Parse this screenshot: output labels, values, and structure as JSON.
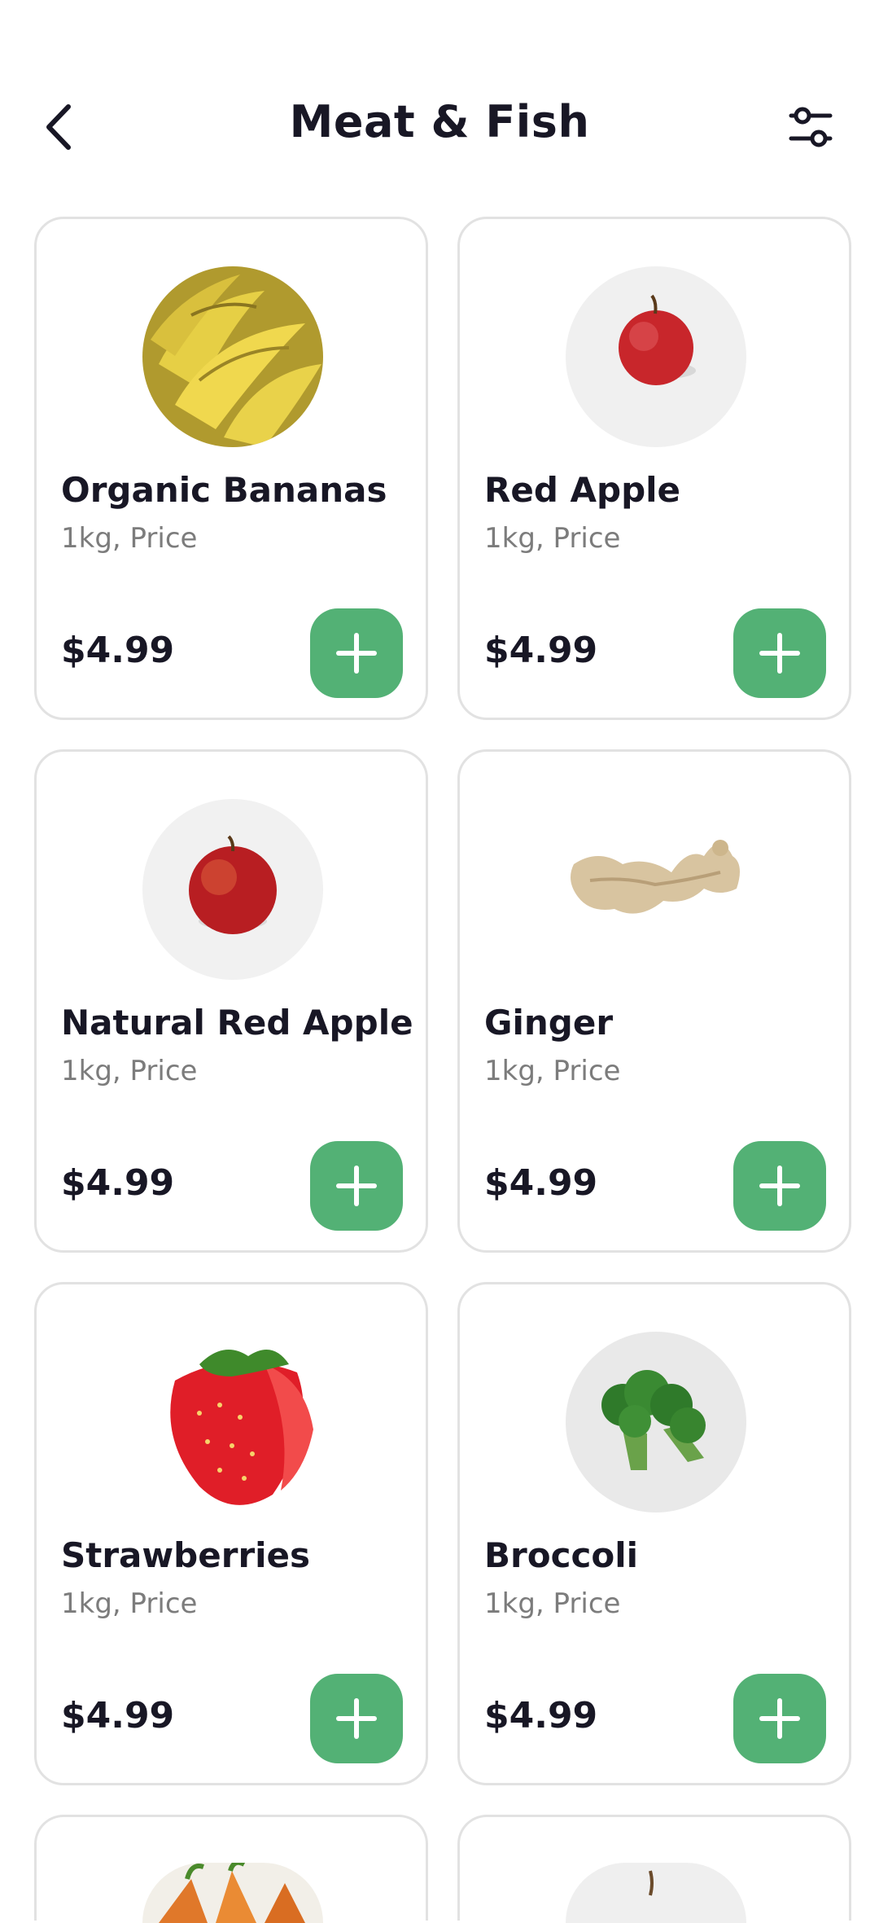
{
  "header": {
    "title": "Meat & Fish",
    "back_icon": "chevron-left-icon",
    "filter_icon": "sliders-icon"
  },
  "colors": {
    "accent": "#53b175",
    "text": "#181725",
    "subtext": "#7c7c7c",
    "border": "#e2e2e2"
  },
  "products": [
    {
      "name": "Organic Bananas",
      "unit": "1kg, Price",
      "price": "$4.99",
      "image": "banana-image"
    },
    {
      "name": "Red Apple",
      "unit": "1kg, Price",
      "price": "$4.99",
      "image": "apple-image"
    },
    {
      "name": "Natural Red Apple",
      "unit": "1kg, Price",
      "price": "$4.99",
      "image": "apple-image"
    },
    {
      "name": "Ginger",
      "unit": "1kg, Price",
      "price": "$4.99",
      "image": "ginger-image"
    },
    {
      "name": "Strawberries",
      "unit": "1kg, Price",
      "price": "$4.99",
      "image": "strawberry-image"
    },
    {
      "name": "Broccoli",
      "unit": "1kg, Price",
      "price": "$4.99",
      "image": "broccoli-image"
    }
  ]
}
